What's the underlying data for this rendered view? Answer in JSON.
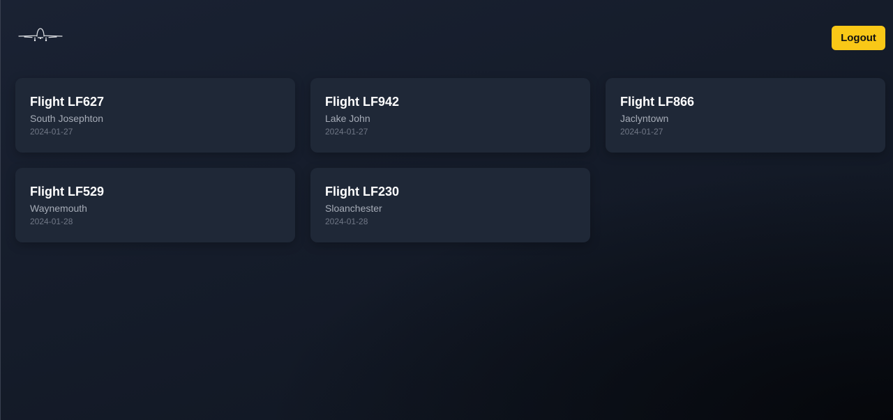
{
  "header": {
    "logo_icon": "airplane-icon",
    "logout_label": "Logout"
  },
  "colors": {
    "accent": "#f9c817",
    "card_bg": "#1f2837",
    "page_bg": "#151c2a"
  },
  "flights": [
    {
      "title": "Flight LF627",
      "city": "South Josephton",
      "date": "2024-01-27"
    },
    {
      "title": "Flight LF942",
      "city": "Lake John",
      "date": "2024-01-27"
    },
    {
      "title": "Flight LF866",
      "city": "Jaclyntown",
      "date": "2024-01-27"
    },
    {
      "title": "Flight LF529",
      "city": "Waynemouth",
      "date": "2024-01-28"
    },
    {
      "title": "Flight LF230",
      "city": "Sloanchester",
      "date": "2024-01-28"
    }
  ]
}
